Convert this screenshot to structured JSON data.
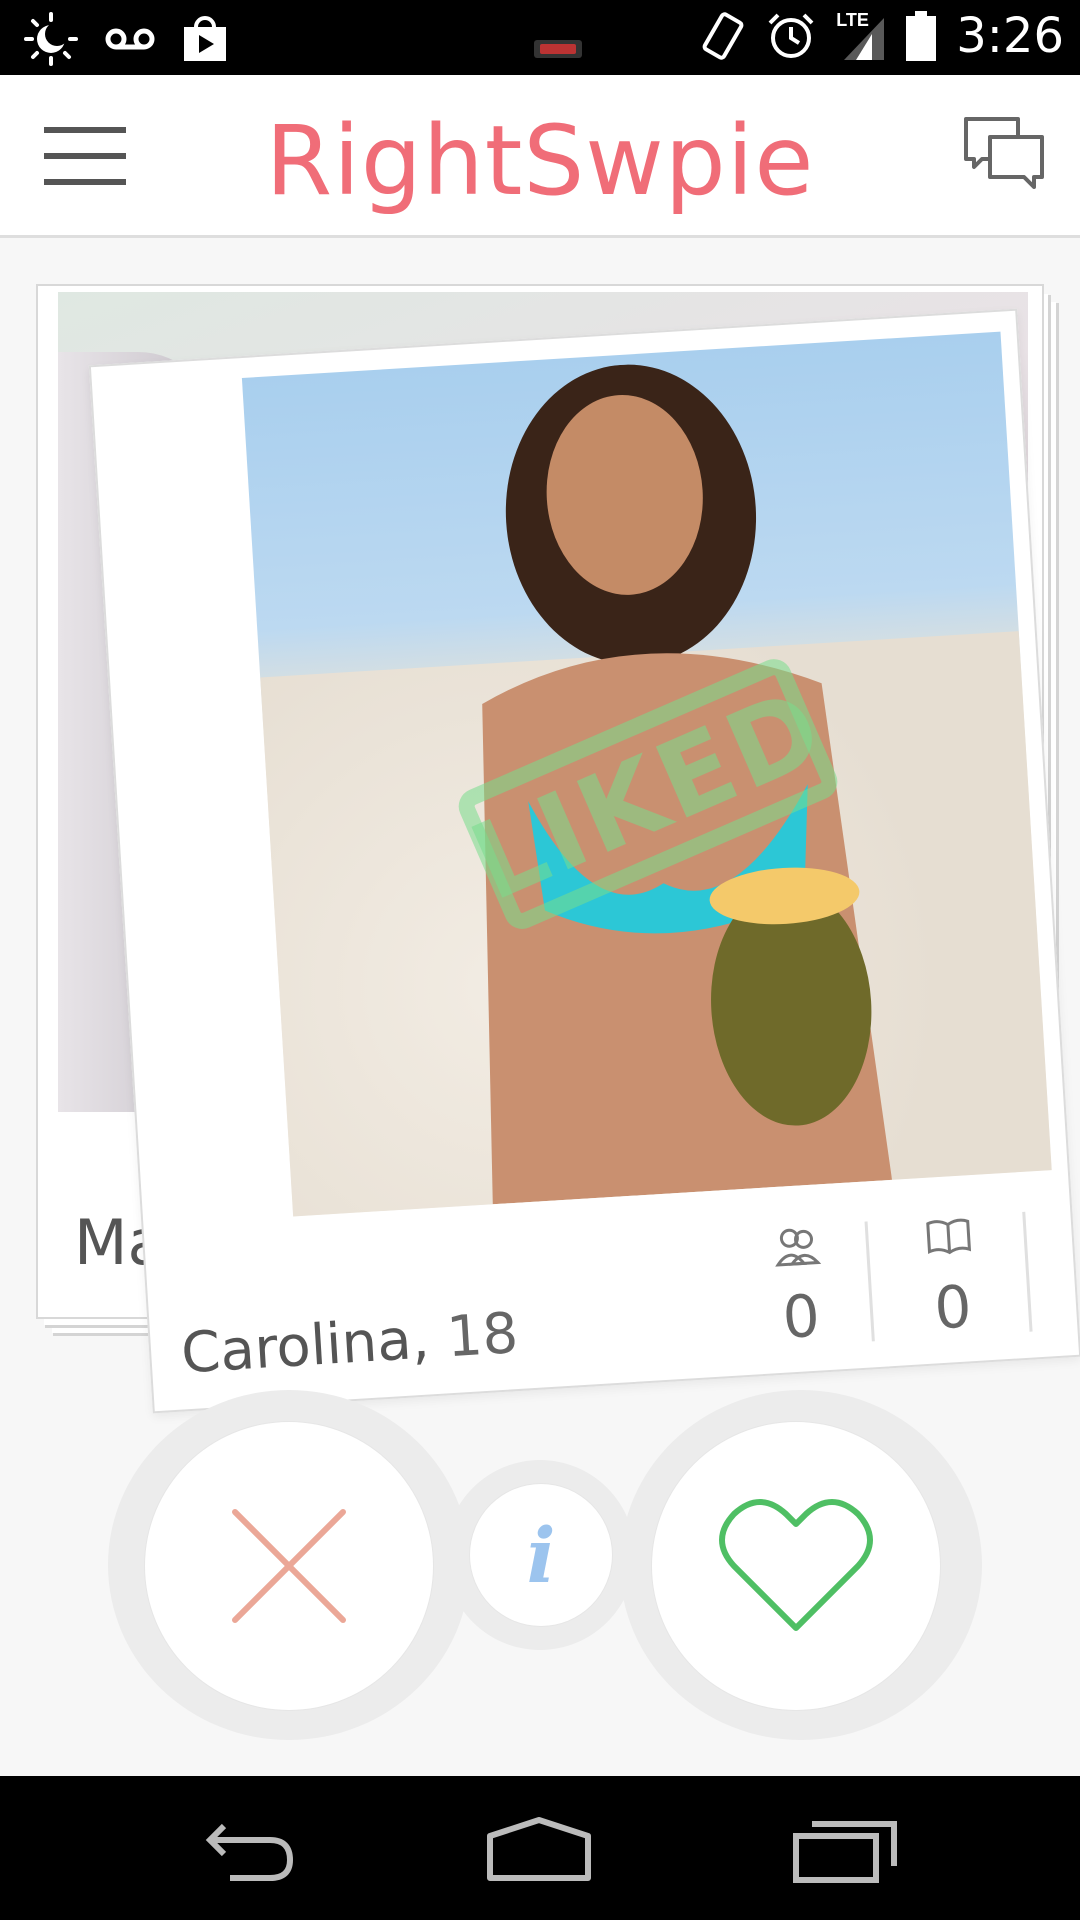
{
  "status_bar": {
    "time": "3:26",
    "network": "LTE",
    "icons": [
      "weather-icon",
      "voicemail-icon",
      "play-store-icon",
      "vibrate-icon",
      "alarm-icon",
      "signal-icon",
      "battery-icon"
    ]
  },
  "app_bar": {
    "title": "RightSwpie",
    "menu_icon": "hamburger-menu-icon",
    "chat_icon": "chat-bubbles-icon"
  },
  "back_card": {
    "name_partial": "Mar"
  },
  "front_card": {
    "name": "Carolina,",
    "age": "18",
    "stamp": "LIKED",
    "stats": [
      {
        "icon": "friends-icon",
        "value": "0"
      },
      {
        "icon": "book-icon",
        "value": "0"
      }
    ]
  },
  "actions": {
    "nope_icon": "close-x-icon",
    "info_label": "i",
    "like_icon": "heart-icon"
  },
  "colors": {
    "brand": "#f06d78",
    "stamp": "#78dc8c",
    "nope": "#eba797",
    "like": "#4fbf64",
    "info": "#9cc4ee"
  },
  "nav_bar": {
    "buttons": [
      "back-icon",
      "home-icon",
      "recents-icon"
    ]
  }
}
